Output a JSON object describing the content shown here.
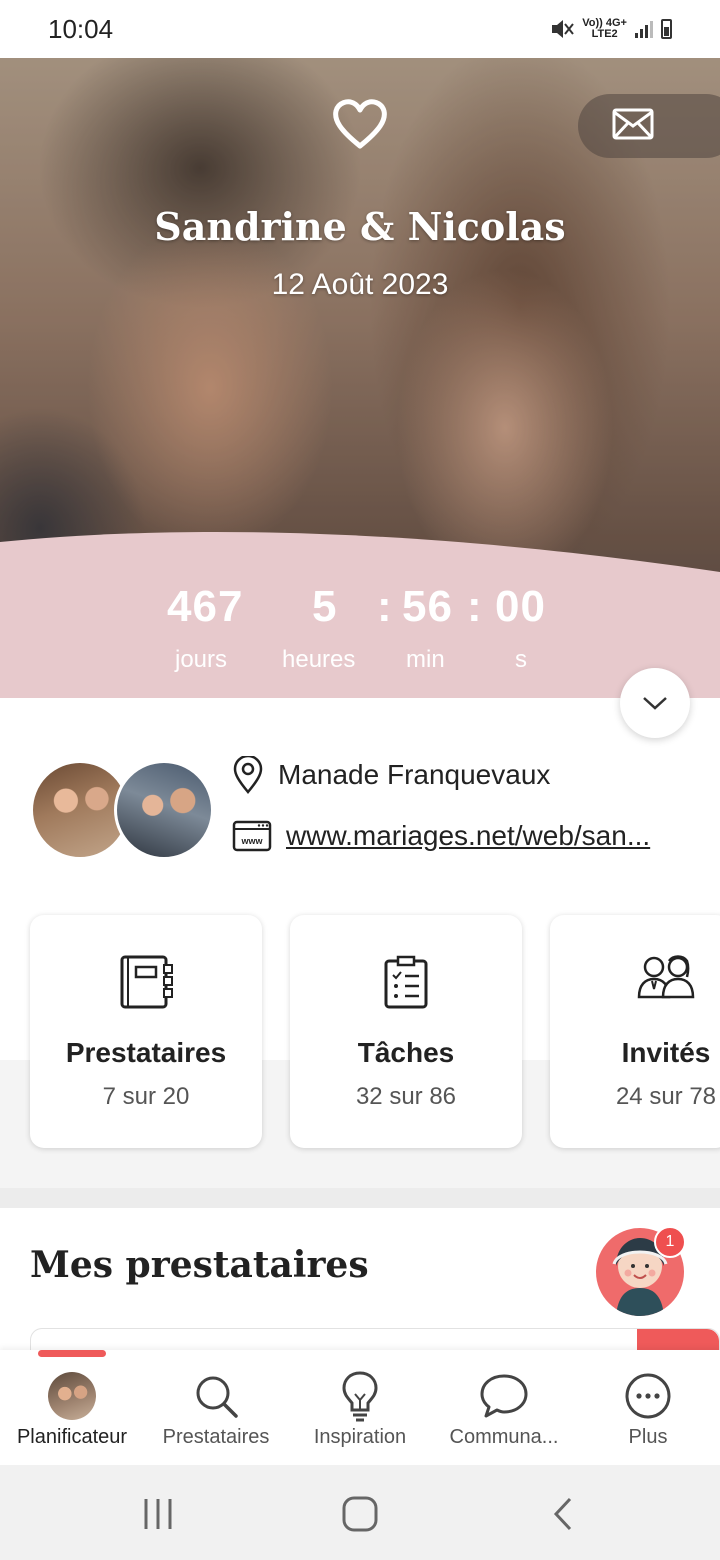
{
  "status_bar": {
    "time": "10:04",
    "network_top": "Vo)) 4G+",
    "network_bottom": "LTE2"
  },
  "hero": {
    "couple_names": "Sandrine & Nicolas",
    "wedding_date": "12 Août 2023",
    "countdown": {
      "days": "467",
      "days_label": "jours",
      "hours": "5",
      "hours_label": "heures",
      "minutes": "56",
      "minutes_label": "min",
      "seconds": "00",
      "seconds_label": "s",
      "separator": ":"
    },
    "band_color": "#e7c9cc"
  },
  "info": {
    "venue": "Manade Franquevaux",
    "website": "www.mariages.net/web/san...",
    "web_icon_text": "www"
  },
  "stats": [
    {
      "title": "Prestataires",
      "sub": "7 sur 20",
      "icon": "notebook-icon"
    },
    {
      "title": "Tâches",
      "sub": "32 sur 86",
      "icon": "checklist-icon"
    },
    {
      "title": "Invités",
      "sub": "24 sur 78",
      "icon": "guests-icon"
    }
  ],
  "section": {
    "title": "Mes prestataires",
    "badge": "1"
  },
  "nav": {
    "items": [
      {
        "label": "Planificateur",
        "icon": "avatar-icon"
      },
      {
        "label": "Prestataires",
        "icon": "search-icon"
      },
      {
        "label": "Inspiration",
        "icon": "lightbulb-icon"
      },
      {
        "label": "Communa...",
        "icon": "chat-bubble-icon"
      },
      {
        "label": "Plus",
        "icon": "more-icon"
      }
    ],
    "accent": "#ef5a5a"
  }
}
